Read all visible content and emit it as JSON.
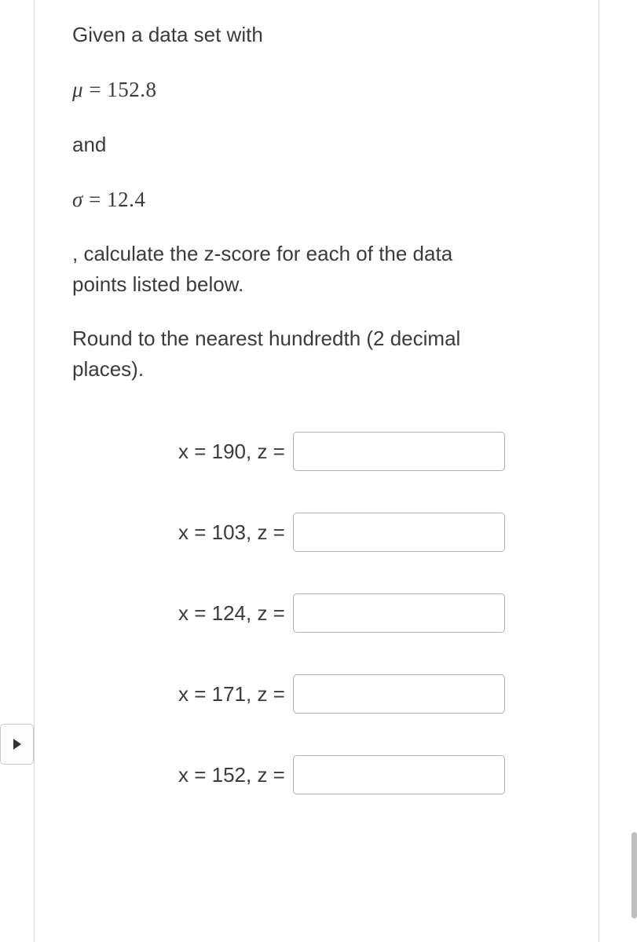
{
  "problem": {
    "intro": "Given a data set with",
    "mu_symbol": "μ",
    "mu_equals": " = ",
    "mu_value": "152.8",
    "and": "and",
    "sigma_symbol": "σ",
    "sigma_equals": " = ",
    "sigma_value": "12.4",
    "instruction1a": ", calculate the z-score for each of the data",
    "instruction1b": "points listed below.",
    "instruction2a": "Round to the nearest hundredth (2 decimal",
    "instruction2b": "places)."
  },
  "rows": [
    {
      "label": "x = 190,  z ="
    },
    {
      "label": "x = 103, z ="
    },
    {
      "label": "x = 124, z ="
    },
    {
      "label": "x = 171, z ="
    },
    {
      "label": "x = 152, z ="
    }
  ]
}
